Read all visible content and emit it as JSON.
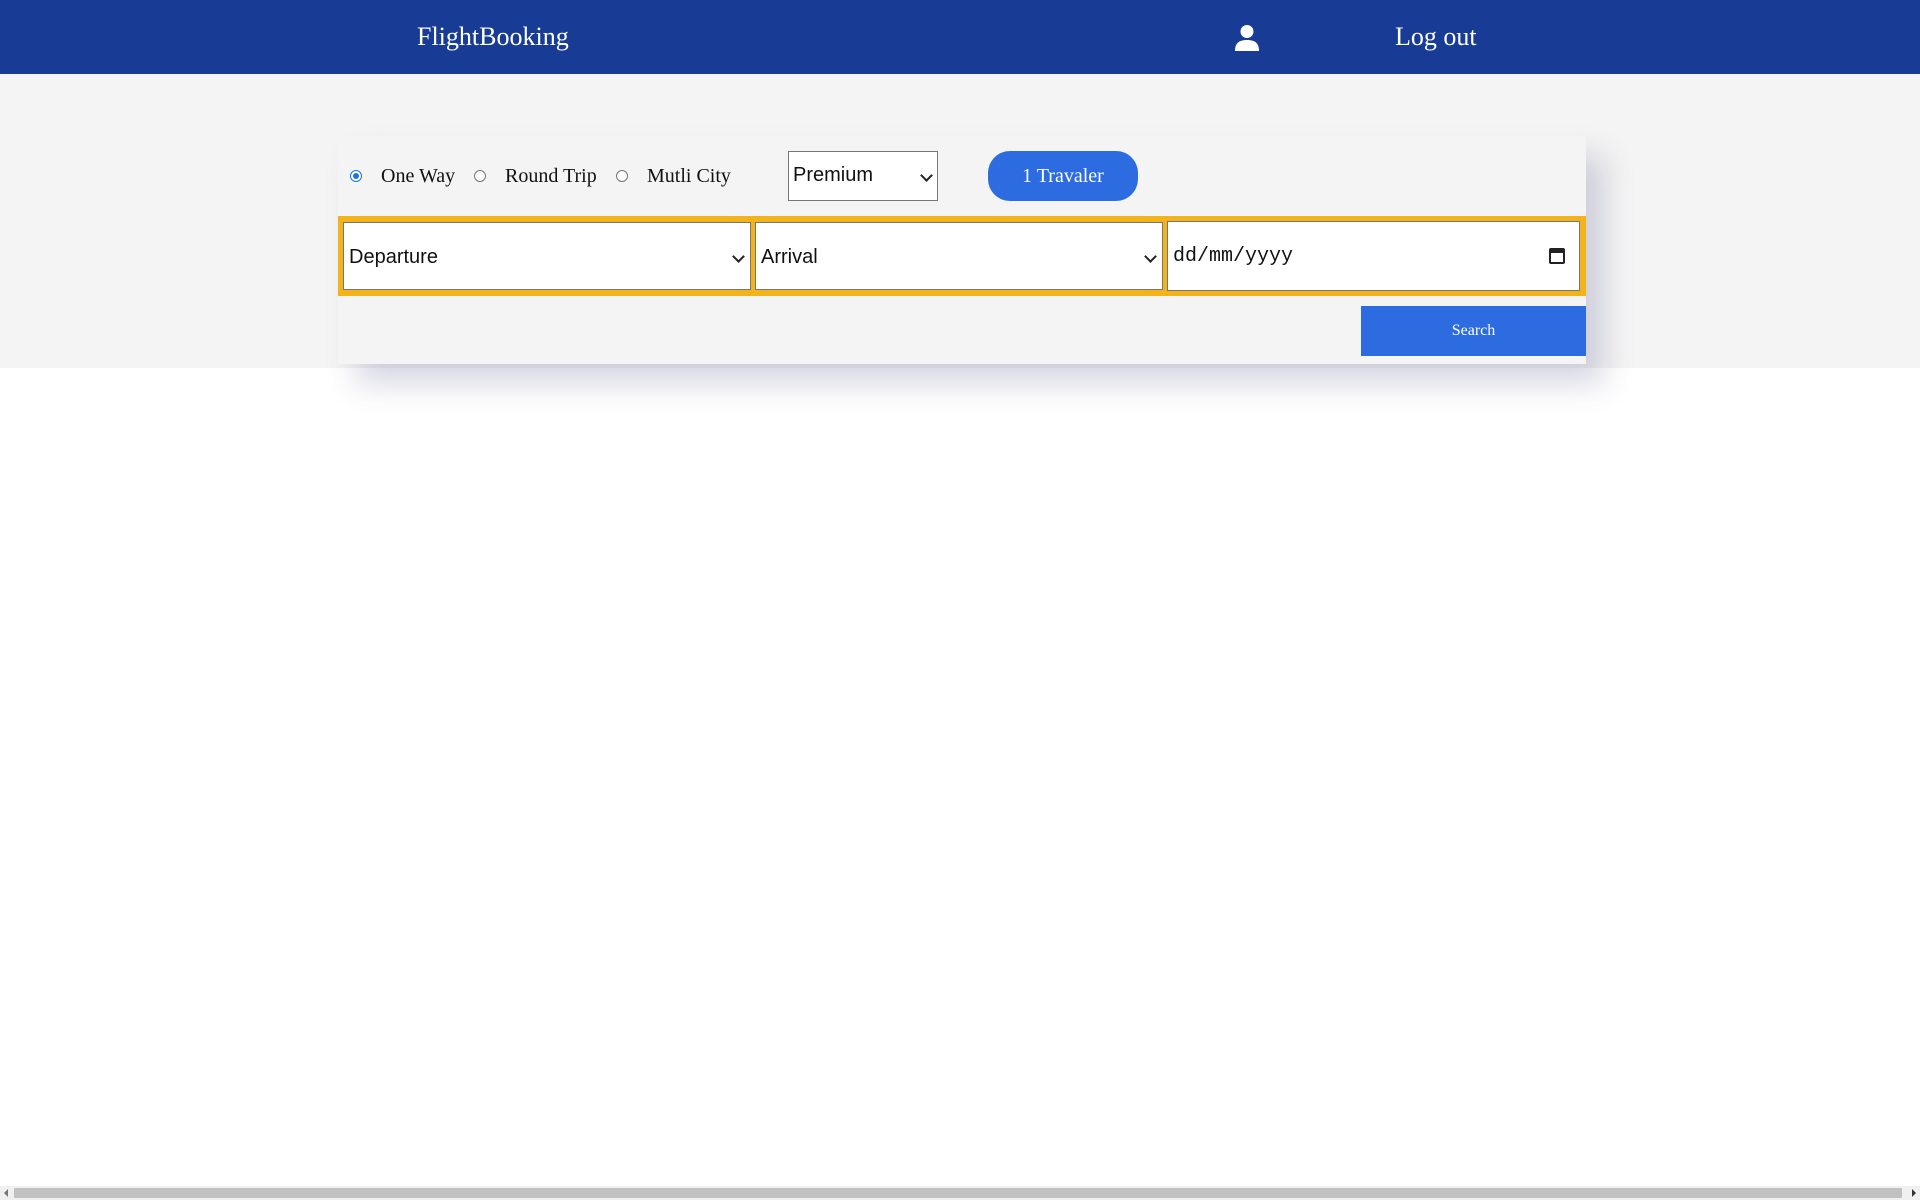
{
  "navbar": {
    "brand": "FlightBooking",
    "user_icon": "user-icon",
    "logout_label": "Log out",
    "background_color": "#183c96"
  },
  "trip_type": {
    "options": [
      {
        "label": "One Way",
        "checked": true
      },
      {
        "label": "Round Trip",
        "checked": false
      },
      {
        "label": "Mutli City",
        "checked": false
      }
    ]
  },
  "cabin_class": {
    "selected": "Premium"
  },
  "travelers": {
    "label": "1 Travaler"
  },
  "search_form": {
    "departure": {
      "selected": "Departure"
    },
    "arrival": {
      "selected": "Arrival"
    },
    "date": {
      "placeholder": "dd/mm/yyyy",
      "icon": "calendar-icon"
    },
    "search_label": "Search",
    "highlight_color": "#f3b31a",
    "accent_color": "#2d6be0"
  }
}
